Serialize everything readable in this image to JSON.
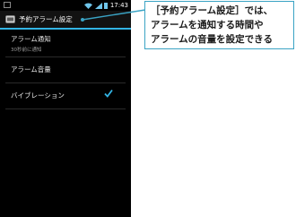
{
  "status_bar": {
    "time": "17:43",
    "icons": [
      "notification-icon",
      "wifi-icon",
      "signal-icon",
      "battery-icon"
    ]
  },
  "action_bar": {
    "title": "予約アラーム設定",
    "icon": "alarm-clock-icon"
  },
  "settings": [
    {
      "label": "アラーム通知",
      "summary": "30秒前に通知"
    },
    {
      "label": "アラーム音量"
    },
    {
      "label": "バイブレーション",
      "checked": true
    }
  ],
  "callout": {
    "lines": [
      "［予約アラーム設定］では、",
      "アラームを通知する時間や",
      "アラームの音量を設定できる"
    ]
  },
  "colors": {
    "accent": "#33b5e5",
    "callout_border": "#3aa3c4",
    "phone_bg": "#000000"
  }
}
